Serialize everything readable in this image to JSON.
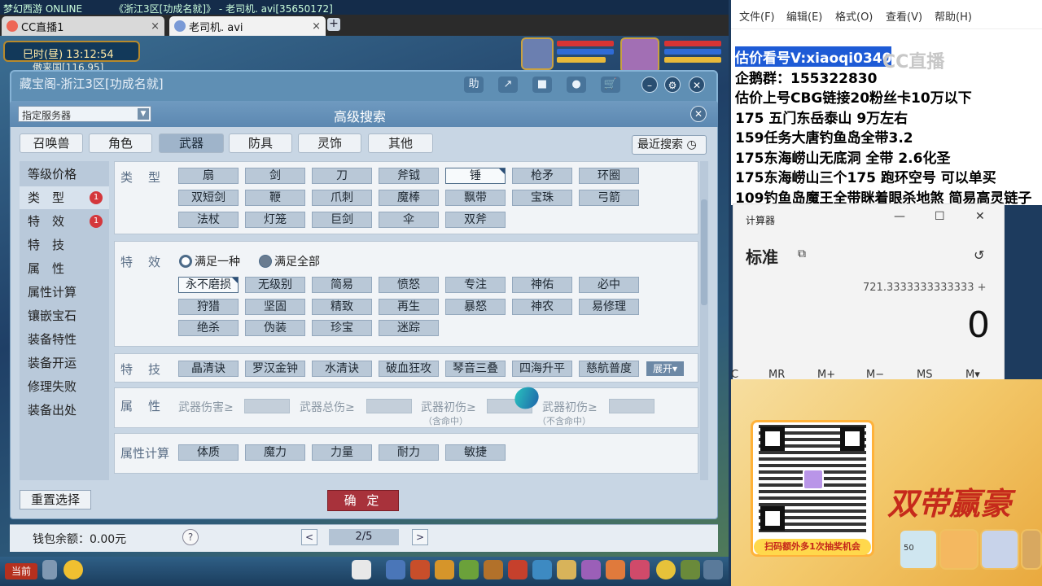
{
  "top_strip": {
    "left": "梦幻西游 ONLINE",
    "right": "《浙江3区[功成名就]》 - 老司机. avi[35650172]"
  },
  "tabs": [
    {
      "label": "CC直播1",
      "close": "×"
    },
    {
      "label": "老司机. avi",
      "close": "×"
    }
  ],
  "add_tab": "+",
  "game": {
    "time": "巳时(昼)  13:12:54",
    "coords": "傲来国[116,95]"
  },
  "window": {
    "title": "藏宝阁-浙江3区[功成名就]",
    "buttons": [
      "助",
      "↗",
      "■",
      "●",
      "🛒"
    ],
    "round_buttons": [
      "–",
      "⚙",
      "✕"
    ]
  },
  "dialog": {
    "title": "高级搜索",
    "server_select": "指定服务器",
    "close": "✕",
    "category_tabs": [
      "召唤兽",
      "角色",
      "武器",
      "防具",
      "灵饰",
      "其他"
    ],
    "active_category": "武器",
    "recent_search": "最近搜索 ◷",
    "nav": [
      {
        "label": "等级价格",
        "badge": ""
      },
      {
        "label": "类　型",
        "badge": "1"
      },
      {
        "label": "特　效",
        "badge": "1"
      },
      {
        "label": "特　技",
        "badge": ""
      },
      {
        "label": "属　性",
        "badge": ""
      },
      {
        "label": "属性计算",
        "badge": ""
      },
      {
        "label": "镶嵌宝石",
        "badge": ""
      },
      {
        "label": "装备特性",
        "badge": ""
      },
      {
        "label": "装备开运",
        "badge": ""
      },
      {
        "label": "修理失败",
        "badge": ""
      },
      {
        "label": "装备出处",
        "badge": ""
      }
    ],
    "type_label": "类　型",
    "types": [
      "扇",
      "剑",
      "刀",
      "斧钺",
      "锤",
      "枪矛",
      "环圈",
      "双短剑",
      "鞭",
      "爪刺",
      "魔棒",
      "飘带",
      "宝珠",
      "弓箭",
      "法杖",
      "灯笼",
      "巨剑",
      "伞",
      "双斧"
    ],
    "selected_type": "锤",
    "effect_label": "特　效",
    "effect_modes": [
      "满足一种",
      "满足全部"
    ],
    "effects": [
      "永不磨损",
      "无级别",
      "简易",
      "愤怒",
      "专注",
      "神佑",
      "必中",
      "狩猎",
      "坚固",
      "精致",
      "再生",
      "暴怒",
      "神农",
      "易修理",
      "绝杀",
      "伪装",
      "珍宝",
      "迷踪"
    ],
    "selected_effect": "永不磨损",
    "skill_label": "特　技",
    "skills": [
      "晶清诀",
      "罗汉金钟",
      "水清诀",
      "破血狂攻",
      "琴音三叠",
      "四海升平",
      "慈航普度"
    ],
    "expand": "展开▾",
    "attr_label": "属　性",
    "attrs": [
      "武器伤害≥",
      "武器总伤≥",
      "武器初伤≥",
      "武器初伤≥"
    ],
    "attr_subs": [
      "（含命中）",
      "（不含命中）"
    ],
    "calc_label": "属性计算",
    "calc_attrs": [
      "体质",
      "魔力",
      "力量",
      "耐力",
      "敏捷"
    ],
    "reset": "重置选择",
    "confirm": "确 定"
  },
  "wallet": {
    "label": "钱包余额：0.00元",
    "help": "?",
    "prev": "<",
    "page": "2/5",
    "next": ">"
  },
  "bottom": {
    "current": "当前"
  },
  "notepad": {
    "menu": [
      "文件(F)",
      "编辑(E)",
      "格式(O)",
      "查看(V)",
      "帮助(H)"
    ],
    "lines": [
      "估价看号V:xiaoqi0340",
      "企鹅群：155322830",
      "估价上号CBG链接20粉丝卡10万以下",
      "175 五门东岳泰山  9万左右",
      "159任务大唐钓鱼岛全带3.2",
      "175东海崂山无底洞  全带   2.6化圣",
      "175东海崂山三个175 跑环空号 可以单买",
      "109钓鱼岛魔王全带眯着眼杀地煞 简易高灵链子"
    ]
  },
  "watermark": "CC直播",
  "calculator": {
    "title": "计算器",
    "controls": [
      "—",
      "☐",
      "✕"
    ],
    "mode": "标准",
    "mode_icon": "⧉",
    "history_icon": "↺",
    "expression": "721.3333333333333 +",
    "result": "0",
    "memory": [
      "C",
      "MR",
      "M+",
      "M−",
      "MS",
      "M▾"
    ]
  },
  "promo": {
    "scan_text": "扫码额外多1次抽奖机会",
    "title": "双带赢豪",
    "badge_text": "50"
  },
  "colors": {
    "accent_red": "#a8323b",
    "dialog_bg": "#c8d6e4",
    "tab_active": "#9fb4ca",
    "badge": "#d4373c"
  }
}
